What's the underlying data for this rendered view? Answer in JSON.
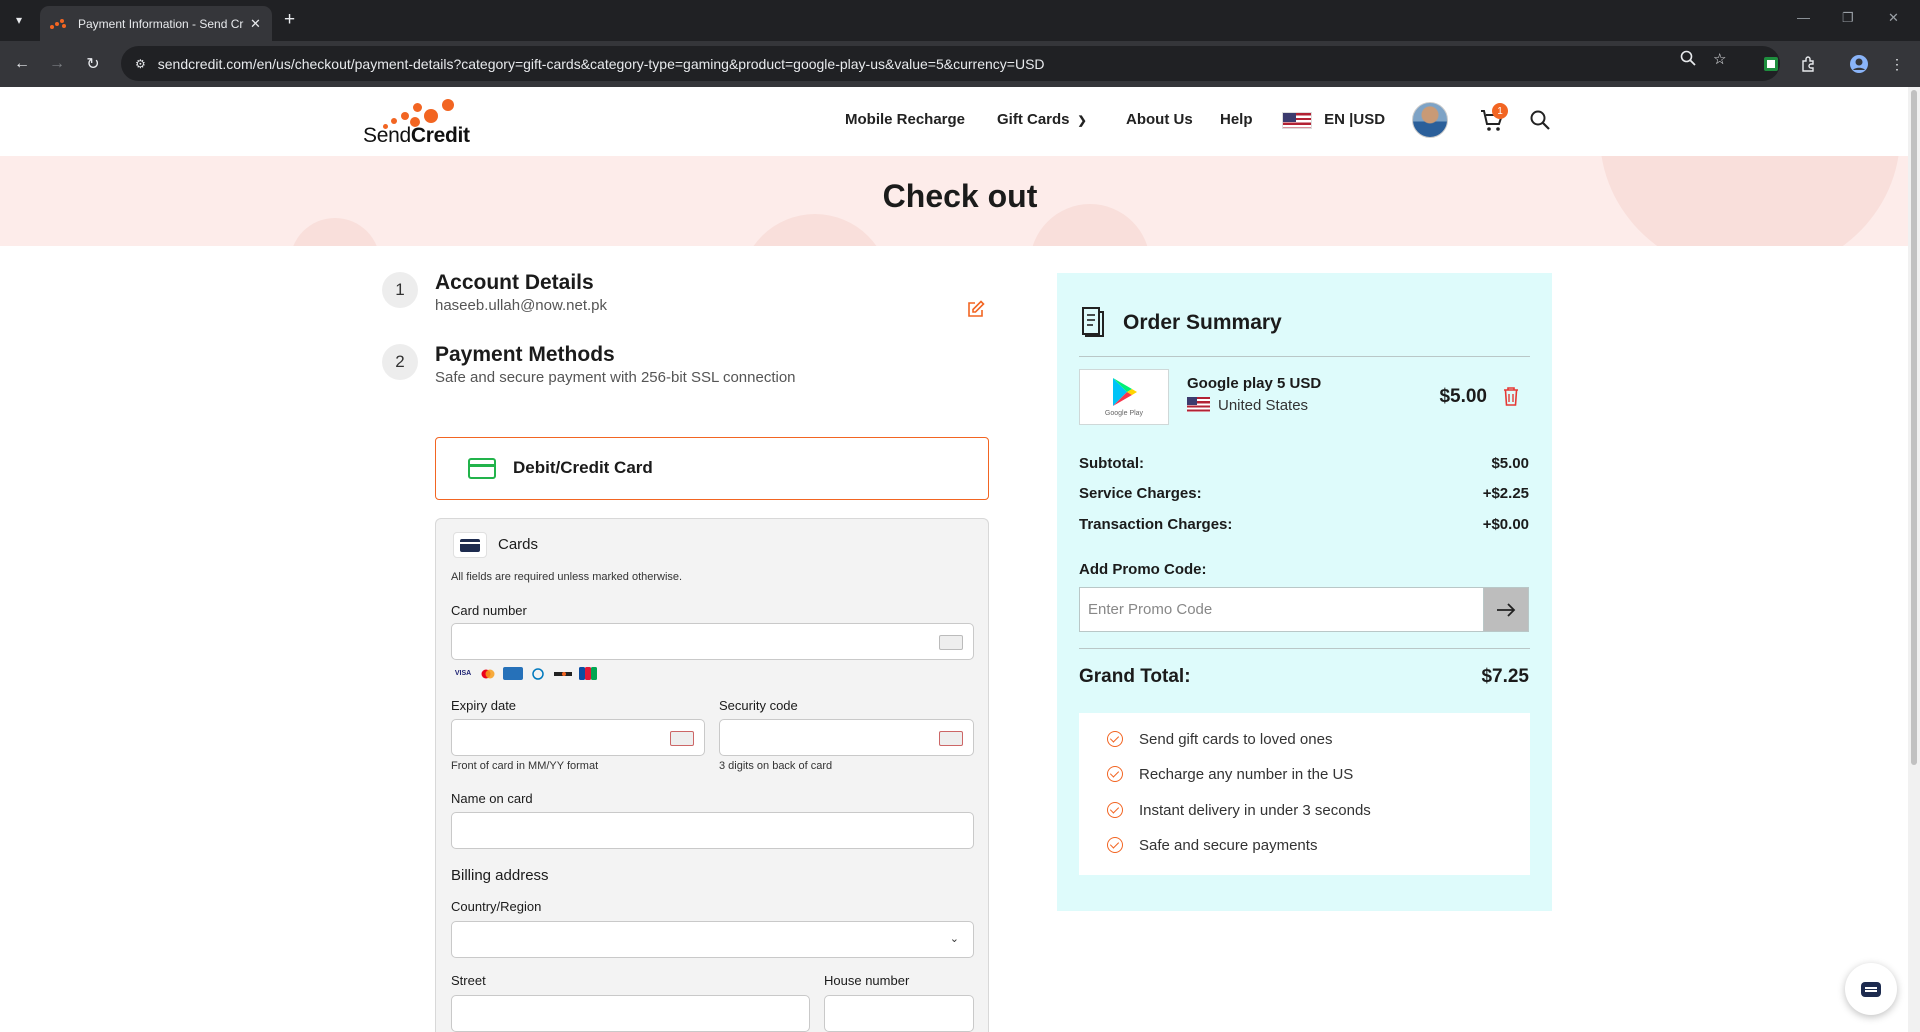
{
  "browser": {
    "tab_title": "Payment Information - Send Cr",
    "url": "sendcredit.com/en/us/checkout/payment-details?category=gift-cards&category-type=gaming&product=google-play-us&value=5&currency=USD",
    "icons": [
      "tab-list-icon",
      "back-icon",
      "forward-icon",
      "reload-icon",
      "site-info-icon",
      "zoom-icon",
      "bookmark-star-icon",
      "extension-icon",
      "puzzle-icon",
      "profile-icon",
      "more-icon"
    ]
  },
  "header": {
    "logo_send": "Send",
    "logo_credit": "Credit",
    "nav": {
      "mobile_recharge": "Mobile Recharge",
      "gift_cards": "Gift Cards",
      "about_us": "About Us",
      "help": "Help",
      "lang": "EN",
      "currency": "USD"
    },
    "cart_count": "1"
  },
  "banner": {
    "title": "Check out"
  },
  "steps": [
    {
      "number": "1",
      "title": "Account Details",
      "subtitle": "haseeb.ullah@now.net.pk"
    },
    {
      "number": "2",
      "title": "Payment Methods",
      "subtitle": "Safe and secure payment with 256-bit SSL connection"
    }
  ],
  "payment_method": {
    "label": "Debit/Credit Card"
  },
  "card_form": {
    "section_title": "Cards",
    "required_note": "All fields are required unless marked otherwise.",
    "card_number_label": "Card number",
    "card_brands": [
      "VISA",
      "MC",
      "AMEX",
      "DINERS",
      "DISCOVER",
      "JCB"
    ],
    "expiry_label": "Expiry date",
    "expiry_hint": "Front of card in MM/YY format",
    "security_label": "Security code",
    "security_hint": "3 digits on back of card",
    "name_label": "Name on card",
    "billing_title": "Billing address",
    "country_label": "Country/Region",
    "street_label": "Street",
    "house_label": "House number"
  },
  "order_summary": {
    "title": "Order Summary",
    "item": {
      "name": "Google play 5 USD",
      "country": "United States",
      "price": "$5.00",
      "image_caption": "Google Play"
    },
    "subtotal_label": "Subtotal:",
    "subtotal_value": "$5.00",
    "service_label": "Service Charges:",
    "service_value": "+$2.25",
    "transaction_label": "Transaction Charges:",
    "transaction_value": "+$0.00",
    "promo_label": "Add Promo Code:",
    "promo_placeholder": "Enter Promo Code",
    "grand_total_label": "Grand Total:",
    "grand_total_value": "$7.25",
    "benefits": [
      "Send gift cards to loved ones",
      "Recharge any number in the US",
      "Instant delivery in under 3 seconds",
      "Safe and secure payments"
    ]
  },
  "colors": {
    "brand_orange": "#f26522",
    "summary_bg": "#defbfb",
    "banner_bg": "#fdecea",
    "card_icon_green": "#22b34b",
    "trash_red": "#e53935"
  }
}
